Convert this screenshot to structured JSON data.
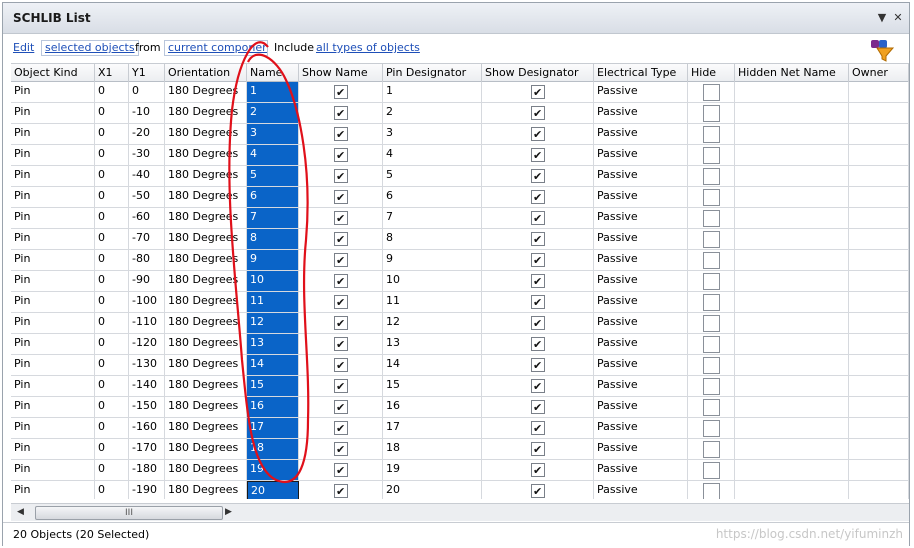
{
  "window": {
    "title": "SCHLIB List",
    "buttons": [
      "▼",
      "✕"
    ]
  },
  "toolbar": {
    "edit_label": "Edit",
    "selected_label": "selected objects",
    "from_label": "from",
    "scope_label": "current component",
    "include_label": "Include",
    "types_label": "all types of objects"
  },
  "columns": [
    "Object Kind",
    "X1",
    "Y1",
    "Orientation",
    "Name",
    "Show Name",
    "Pin Designator",
    "Show Designator",
    "Electrical Type",
    "Hide",
    "Hidden Net Name",
    "Owner"
  ],
  "rows": [
    {
      "kind": "Pin",
      "x1": "0",
      "y1": "0",
      "orientation": "180 Degrees",
      "name": "1",
      "show_name": true,
      "designator": "1",
      "show_designator": true,
      "type": "Passive",
      "hide": false
    },
    {
      "kind": "Pin",
      "x1": "0",
      "y1": "-10",
      "orientation": "180 Degrees",
      "name": "2",
      "show_name": true,
      "designator": "2",
      "show_designator": true,
      "type": "Passive",
      "hide": false
    },
    {
      "kind": "Pin",
      "x1": "0",
      "y1": "-20",
      "orientation": "180 Degrees",
      "name": "3",
      "show_name": true,
      "designator": "3",
      "show_designator": true,
      "type": "Passive",
      "hide": false
    },
    {
      "kind": "Pin",
      "x1": "0",
      "y1": "-30",
      "orientation": "180 Degrees",
      "name": "4",
      "show_name": true,
      "designator": "4",
      "show_designator": true,
      "type": "Passive",
      "hide": false
    },
    {
      "kind": "Pin",
      "x1": "0",
      "y1": "-40",
      "orientation": "180 Degrees",
      "name": "5",
      "show_name": true,
      "designator": "5",
      "show_designator": true,
      "type": "Passive",
      "hide": false
    },
    {
      "kind": "Pin",
      "x1": "0",
      "y1": "-50",
      "orientation": "180 Degrees",
      "name": "6",
      "show_name": true,
      "designator": "6",
      "show_designator": true,
      "type": "Passive",
      "hide": false
    },
    {
      "kind": "Pin",
      "x1": "0",
      "y1": "-60",
      "orientation": "180 Degrees",
      "name": "7",
      "show_name": true,
      "designator": "7",
      "show_designator": true,
      "type": "Passive",
      "hide": false
    },
    {
      "kind": "Pin",
      "x1": "0",
      "y1": "-70",
      "orientation": "180 Degrees",
      "name": "8",
      "show_name": true,
      "designator": "8",
      "show_designator": true,
      "type": "Passive",
      "hide": false
    },
    {
      "kind": "Pin",
      "x1": "0",
      "y1": "-80",
      "orientation": "180 Degrees",
      "name": "9",
      "show_name": true,
      "designator": "9",
      "show_designator": true,
      "type": "Passive",
      "hide": false
    },
    {
      "kind": "Pin",
      "x1": "0",
      "y1": "-90",
      "orientation": "180 Degrees",
      "name": "10",
      "show_name": true,
      "designator": "10",
      "show_designator": true,
      "type": "Passive",
      "hide": false
    },
    {
      "kind": "Pin",
      "x1": "0",
      "y1": "-100",
      "orientation": "180 Degrees",
      "name": "11",
      "show_name": true,
      "designator": "11",
      "show_designator": true,
      "type": "Passive",
      "hide": false
    },
    {
      "kind": "Pin",
      "x1": "0",
      "y1": "-110",
      "orientation": "180 Degrees",
      "name": "12",
      "show_name": true,
      "designator": "12",
      "show_designator": true,
      "type": "Passive",
      "hide": false
    },
    {
      "kind": "Pin",
      "x1": "0",
      "y1": "-120",
      "orientation": "180 Degrees",
      "name": "13",
      "show_name": true,
      "designator": "13",
      "show_designator": true,
      "type": "Passive",
      "hide": false
    },
    {
      "kind": "Pin",
      "x1": "0",
      "y1": "-130",
      "orientation": "180 Degrees",
      "name": "14",
      "show_name": true,
      "designator": "14",
      "show_designator": true,
      "type": "Passive",
      "hide": false
    },
    {
      "kind": "Pin",
      "x1": "0",
      "y1": "-140",
      "orientation": "180 Degrees",
      "name": "15",
      "show_name": true,
      "designator": "15",
      "show_designator": true,
      "type": "Passive",
      "hide": false
    },
    {
      "kind": "Pin",
      "x1": "0",
      "y1": "-150",
      "orientation": "180 Degrees",
      "name": "16",
      "show_name": true,
      "designator": "16",
      "show_designator": true,
      "type": "Passive",
      "hide": false
    },
    {
      "kind": "Pin",
      "x1": "0",
      "y1": "-160",
      "orientation": "180 Degrees",
      "name": "17",
      "show_name": true,
      "designator": "17",
      "show_designator": true,
      "type": "Passive",
      "hide": false
    },
    {
      "kind": "Pin",
      "x1": "0",
      "y1": "-170",
      "orientation": "180 Degrees",
      "name": "18",
      "show_name": true,
      "designator": "18",
      "show_designator": true,
      "type": "Passive",
      "hide": false
    },
    {
      "kind": "Pin",
      "x1": "0",
      "y1": "-180",
      "orientation": "180 Degrees",
      "name": "19",
      "show_name": true,
      "designator": "19",
      "show_designator": true,
      "type": "Passive",
      "hide": false
    },
    {
      "kind": "Pin",
      "x1": "0",
      "y1": "-190",
      "orientation": "180 Degrees",
      "name": "20",
      "show_name": true,
      "designator": "20",
      "show_designator": true,
      "type": "Passive",
      "hide": false
    }
  ],
  "scrollbar": {
    "thumb_label": "III",
    "left_arrow": "◀",
    "right_arrow": "▶"
  },
  "status": {
    "text": "20 Objects (20 Selected)",
    "watermark": "https://blog.csdn.net/yifuminzh"
  },
  "colors": {
    "selection": "#0a64c8",
    "link": "#1e4fb8",
    "annotation": "#e0101a"
  }
}
